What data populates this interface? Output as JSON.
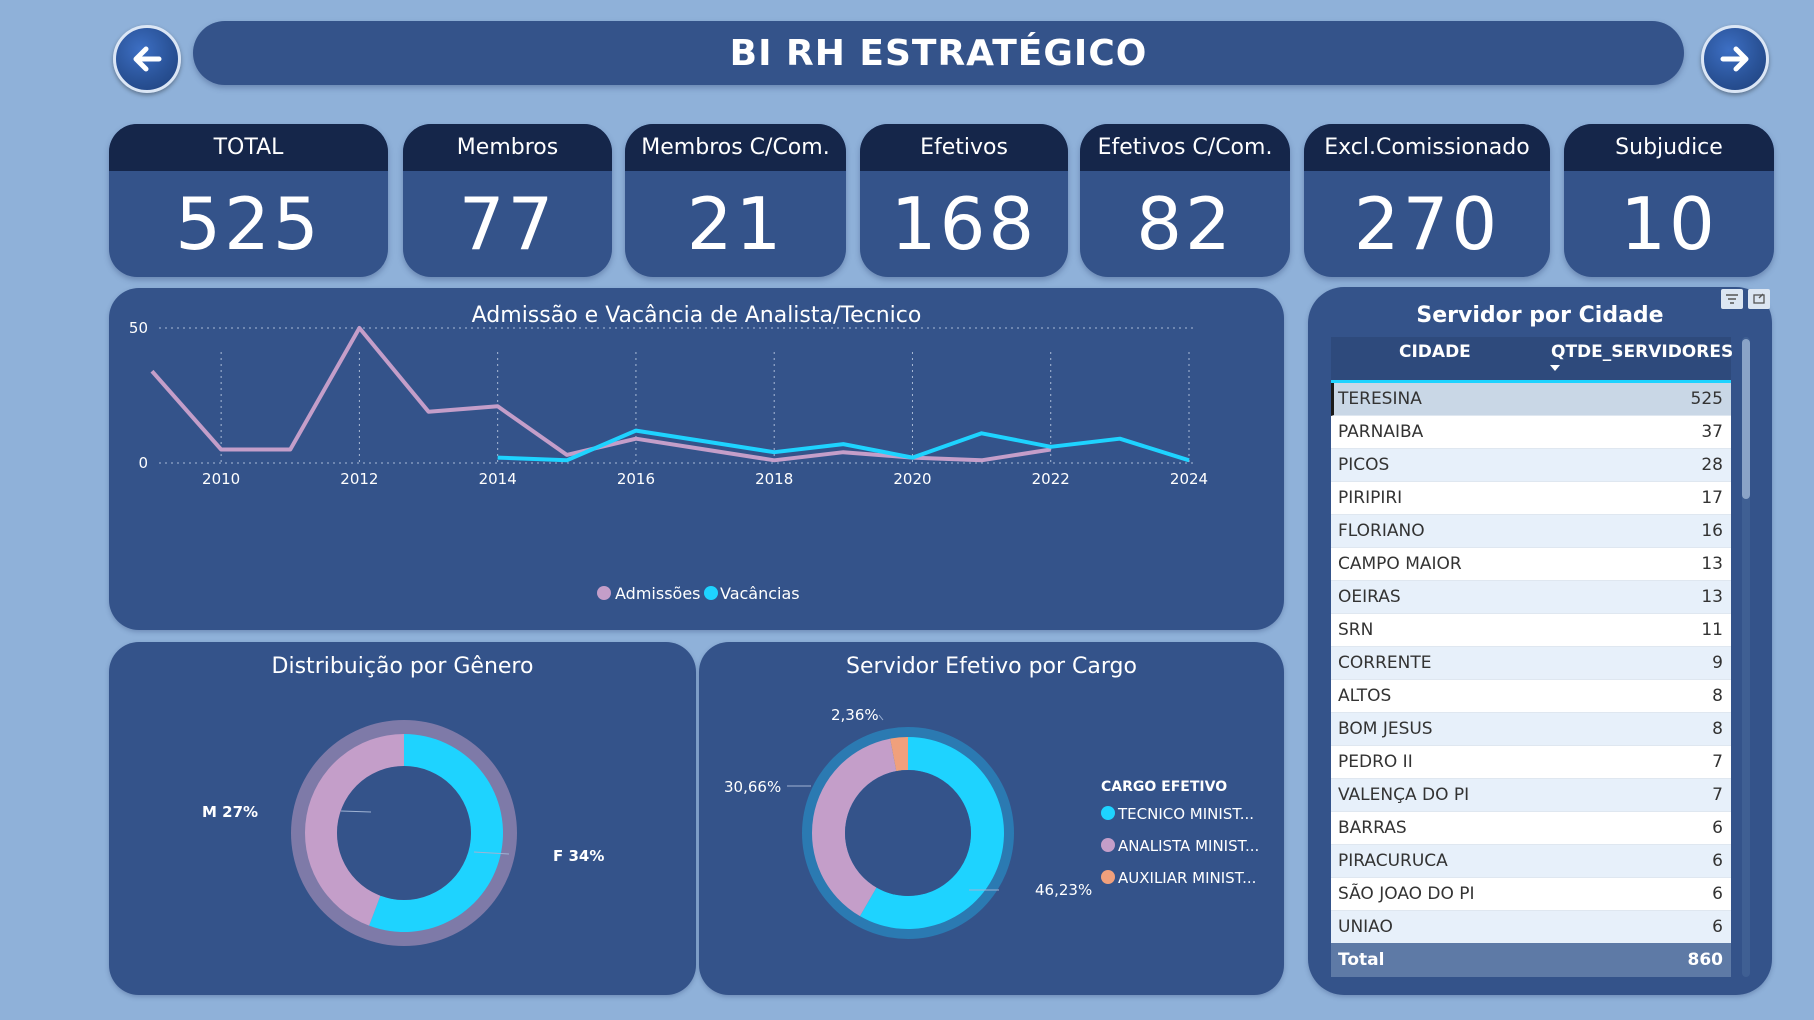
{
  "header": {
    "title": "BI RH ESTRATÉGICO"
  },
  "nav": {
    "back_icon": "arrow-left-icon",
    "forward_icon": "arrow-right-icon"
  },
  "kpis": [
    {
      "label": "TOTAL",
      "value": "525"
    },
    {
      "label": "Membros",
      "value": "77"
    },
    {
      "label": "Membros C/Com.",
      "value": "21"
    },
    {
      "label": "Efetivos",
      "value": "168"
    },
    {
      "label": "Efetivos C/Com.",
      "value": "82"
    },
    {
      "label": "Excl.Comissionado",
      "value": "270"
    },
    {
      "label": "Subjudice",
      "value": "10"
    }
  ],
  "colors": {
    "admissoes": "#c49ec9",
    "vacancias": "#1ed3ff",
    "auxiliar": "#f0a07c",
    "panel": "#34538a",
    "background": "#8fb1d9"
  },
  "line_chart": {
    "title": "Admissão e Vacância de Analista/Tecnico",
    "chart_data": {
      "type": "line",
      "x_ticks": [
        "2010",
        "2012",
        "2014",
        "2016",
        "2018",
        "2020",
        "2022",
        "2024"
      ],
      "y_ticks": [
        "0",
        "50"
      ],
      "ylim": [
        0,
        50
      ],
      "xlim": [
        2009,
        2024
      ],
      "series": [
        {
          "name": "Admissões",
          "x": [
            2009,
            2010,
            2011,
            2012,
            2013,
            2014,
            2015,
            2016,
            2017,
            2018,
            2019,
            2020,
            2021,
            2022
          ],
          "values": [
            34,
            5,
            5,
            50,
            19,
            21,
            3,
            9,
            5,
            1,
            4,
            2,
            1,
            5
          ]
        },
        {
          "name": "Vacâncias",
          "x": [
            2014,
            2015,
            2016,
            2017,
            2018,
            2019,
            2020,
            2021,
            2022,
            2023,
            2024
          ],
          "values": [
            2,
            1,
            12,
            8,
            4,
            7,
            2,
            11,
            6,
            9,
            1
          ]
        }
      ],
      "legend_position": "bottom"
    }
  },
  "gender_chart": {
    "title": "Distribuição por Gênero",
    "chart_data": {
      "type": "pie",
      "slices": [
        {
          "label": "F 34%",
          "value": 34
        },
        {
          "label": "M 27%",
          "value": 27
        }
      ]
    }
  },
  "cargo_chart": {
    "title": "Servidor Efetivo por Cargo",
    "legend_title": "CARGO EFETIVO",
    "chart_data": {
      "type": "pie",
      "slices": [
        {
          "name": "TECNICO MINIST...",
          "label": "46,23%",
          "value": 46.23
        },
        {
          "name": "ANALISTA MINIST...",
          "label": "30,66%",
          "value": 30.66
        },
        {
          "name": "AUXILIAR MINIST...",
          "label": "2,36%",
          "value": 2.36
        }
      ]
    }
  },
  "city_table": {
    "title": "Servidor por Cidade",
    "col_city": "CIDADE",
    "col_qty": "QTDE_SERVIDORES",
    "rows": [
      {
        "city": "TERESINA",
        "qty": "525"
      },
      {
        "city": "PARNAIBA",
        "qty": "37"
      },
      {
        "city": "PICOS",
        "qty": "28"
      },
      {
        "city": "PIRIPIRI",
        "qty": "17"
      },
      {
        "city": "FLORIANO",
        "qty": "16"
      },
      {
        "city": "CAMPO MAIOR",
        "qty": "13"
      },
      {
        "city": "OEIRAS",
        "qty": "13"
      },
      {
        "city": "SRN",
        "qty": "11"
      },
      {
        "city": "CORRENTE",
        "qty": "9"
      },
      {
        "city": "ALTOS",
        "qty": "8"
      },
      {
        "city": "BOM JESUS",
        "qty": "8"
      },
      {
        "city": "PEDRO II",
        "qty": "7"
      },
      {
        "city": "VALENÇA DO PI",
        "qty": "7"
      },
      {
        "city": "BARRAS",
        "qty": "6"
      },
      {
        "city": "PIRACURUCA",
        "qty": "6"
      },
      {
        "city": "SÃO JOAO DO PI",
        "qty": "6"
      },
      {
        "city": "UNIAO",
        "qty": "6"
      }
    ],
    "total_label": "Total",
    "total_value": "860"
  }
}
